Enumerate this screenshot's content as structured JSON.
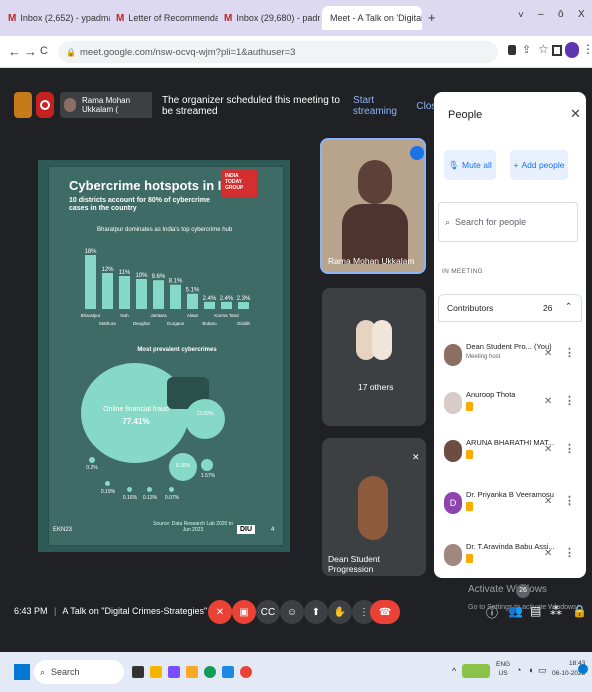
{
  "browser": {
    "tabs": [
      {
        "label": "Inbox (2,652) - ypadmasa@gm",
        "close": "x"
      },
      {
        "label": "Letter of Recommendation-Win",
        "close": "x"
      },
      {
        "label": "Inbox (29,680) - padmasa_y@",
        "close": "x"
      },
      {
        "label": "Meet - A Talk on 'Digital Cr",
        "close": "x"
      }
    ],
    "new_tab": "+",
    "window_controls": [
      "˅",
      "–",
      "ō",
      "X"
    ],
    "url": "meet.google.com/nsw-ocvq-wjm?pli=1&authuser=3",
    "nav": [
      "←",
      "→",
      "C"
    ]
  },
  "meet": {
    "presenter_chip": "Rama Mohan Ukkalam (",
    "banner_text": "The organizer scheduled this meeting to be streamed",
    "banner_action": "Start streaming",
    "banner_close": "Close",
    "slide": {
      "title": "Cybercrime hotspots in India",
      "subtitle": "10 districts account for 80% of cybercrime cases in the country",
      "chart_caption": "Bharatpur dominates as India's top cybercrime hub",
      "section_title": "Most prevalent cybercrimes",
      "footer_left": "EKN23",
      "footer_right": "DIU",
      "page_num": "4",
      "source_note": "Source: Data Research Lab 2020 to Jun 2023",
      "logo_text": "INDIA TODAY GROUP",
      "signature": "A.R.M"
    },
    "tiles": {
      "speaker": "Rama Mohan Ukkalam",
      "others": "17 others",
      "dean": "Dean Student Progression"
    },
    "bottom": {
      "time": "6:43 PM",
      "meeting_title": "A Talk on \"Digital Crimes-Strategies\" Organ...",
      "watermark_1": "Activate Windows",
      "watermark_2": "Go to Settings to activate Windows.",
      "people_count": "26"
    }
  },
  "people_panel": {
    "title": "People",
    "mute_all": "Mute all",
    "add_people": "Add people",
    "search_placeholder": "Search for people",
    "section": "IN MEETING",
    "contributors_label": "Contributors",
    "contributors_count": "26",
    "participants": [
      {
        "name": "Dean Student Pro...  (You)",
        "sub": "Meeting host"
      },
      {
        "name": "Anuroop Thota",
        "sub": ""
      },
      {
        "name": "ARUNA BHARATHI MAT...",
        "sub": ""
      },
      {
        "name": "Dr. Priyanka B Veeramosu",
        "sub": ""
      },
      {
        "name": "Dr. T.Aravinda Babu Assi...",
        "sub": ""
      }
    ]
  },
  "taskbar": {
    "search": "Search",
    "lang": "ENG",
    "region": "US",
    "time": "18:43",
    "date": "06-10-2023"
  },
  "chart_data": {
    "type": "bar",
    "title": "Bharatpur dominates as India's top cybercrime hub",
    "categories": [
      "Bharatpur",
      "Mathura",
      "Nuh",
      "Deoghar",
      "Jamtara",
      "Gurgaon",
      "Alwar",
      "Bokaro",
      "Karma Tand",
      "Giridih"
    ],
    "values": [
      18,
      12,
      11,
      10,
      9.6,
      8.1,
      5.1,
      2.4,
      2.4,
      2.3
    ],
    "value_labels": [
      "18%",
      "12%",
      "11%",
      "10%",
      "9.6%",
      "8.1%",
      "5.1%",
      "2.4%",
      "2.4%",
      "2.3%"
    ],
    "ylim": [
      0,
      20
    ]
  },
  "bubbles": [
    {
      "label": "Online financial fraud",
      "value": "77.41%"
    },
    {
      "label": "Online and social media related crime",
      "value": "12.02%"
    },
    {
      "label": "Any other cybercrime",
      "value": "8.18%"
    },
    {
      "label": "Hacking/Damage to computer, computer systems etc.",
      "value": "1.57%"
    },
    {
      "label": "Online gambling",
      "value": "0.2%"
    },
    {
      "label": "Cryptocurrency crime",
      "value": "0.19%"
    },
    {
      "label": "Cyber terrorism",
      "value": "0.16%"
    },
    {
      "label": "Online cyber trafficking",
      "value": "0.13%"
    },
    {
      "label": "Ransomware",
      "value": "0.07%"
    }
  ],
  "colors": {
    "meet_bg": "#202124",
    "accent": "#1a73e8",
    "end_call": "#ea4335",
    "slide_bg": "#3f6b66",
    "bar": "#86d9c6"
  }
}
